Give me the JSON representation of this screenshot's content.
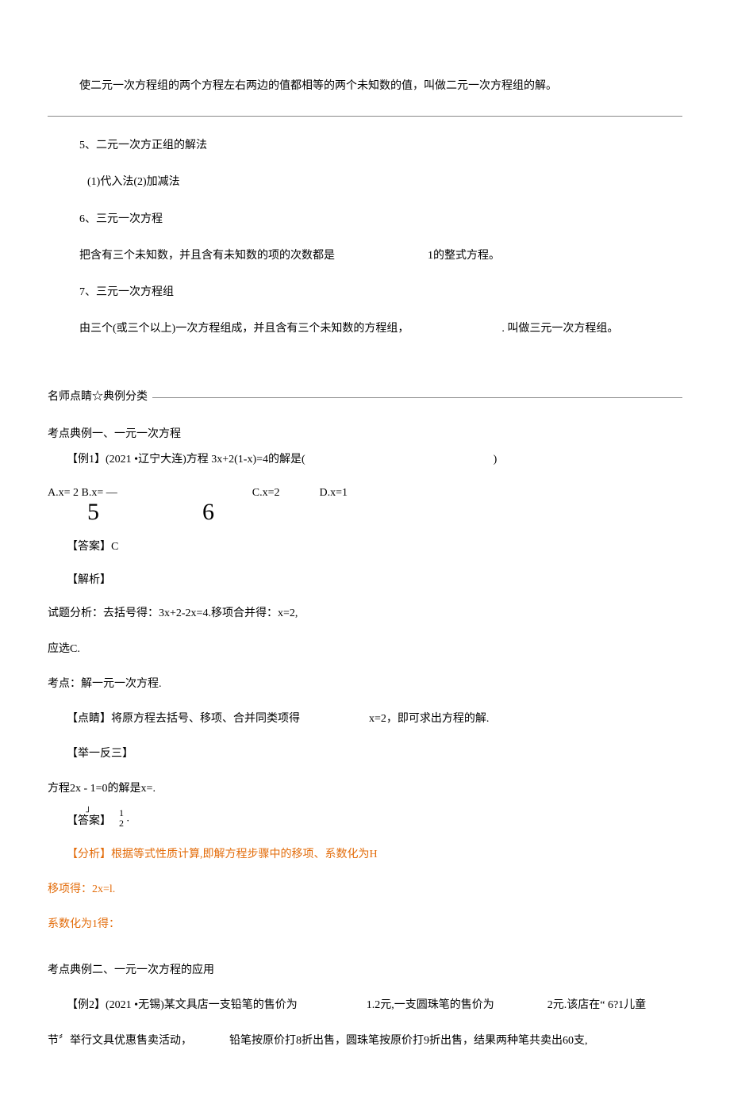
{
  "p1": "使二元一次方程组的两个方程左右两边的值都相等的两个未知数的值，叫做二元一次方程组的解。",
  "p2": "5、二元一次方正组的解法",
  "p3": "(1)代入法(2)加减法",
  "p4": "6、三元一次方程",
  "p5": "把含有三个未知数，并且含有未知数的项的次数都是",
  "p5b": "1的整式方程。",
  "p6": "7、三元一次方程组",
  "p7": "由三个(或三个以上)一次方程组成，并且含有三个未知数的方程组，",
  "p7b": ". 叫做三元一次方程组。",
  "section": "名师点睛☆典例分类",
  "ex1_title": "考点典例一、一元一次方程",
  "ex1_q": "【例1】(2021 •辽宁大连)方程  3x+2(1-x)=4的解是(",
  "ex1_paren": ")",
  "choices_ab": "A.x= 2 B.x= —",
  "choice_c": "C.x=2",
  "choice_d": "D.x=1",
  "frac_a": "5",
  "frac_b": "6",
  "ans_label": "【答案】C",
  "analysis_label": "【解析】",
  "analysis1": "试题分析：去括号得：3x+2-2x=4.移项合并得：x=2,",
  "analysis2": "应选C.",
  "kaodian": "考点：解一元一次方程.",
  "dianjing_a": "【点睛】将原方程去括号、移项、合并同类项得",
  "dianjing_b": "x=2，即可求出方程的解.",
  "juyifansan": "【举一反三】",
  "fangcheng": "方程2x - 1=0的解是x=.",
  "answer2_label": "【答案】",
  "answer2_top": "1",
  "answer2_bot": "2",
  "answer2_period": ".",
  "answer2_mark": "」",
  "fenxi": "【分析】根据等式性质计算,即解方程步骤中的移项、系数化为H",
  "yixiang": "移项得：2x=l.",
  "xishu": "系数化为1得：",
  "ex2_title": "考点典例二、一元一次方程的应用",
  "ex2_a": "【例2】(2021 •无锡)某文具店一支铅笔的售价为",
  "ex2_b": "1.2元,一支圆珠笔的售价为",
  "ex2_c": "2元.该店在“  6?1儿童",
  "ex2_line2a": "节〞举行文具优惠售卖活动，",
  "ex2_line2b": "铅笔按原价打8折出售，圆珠笔按原价打9折出售，结果两种笔共卖出60支,"
}
